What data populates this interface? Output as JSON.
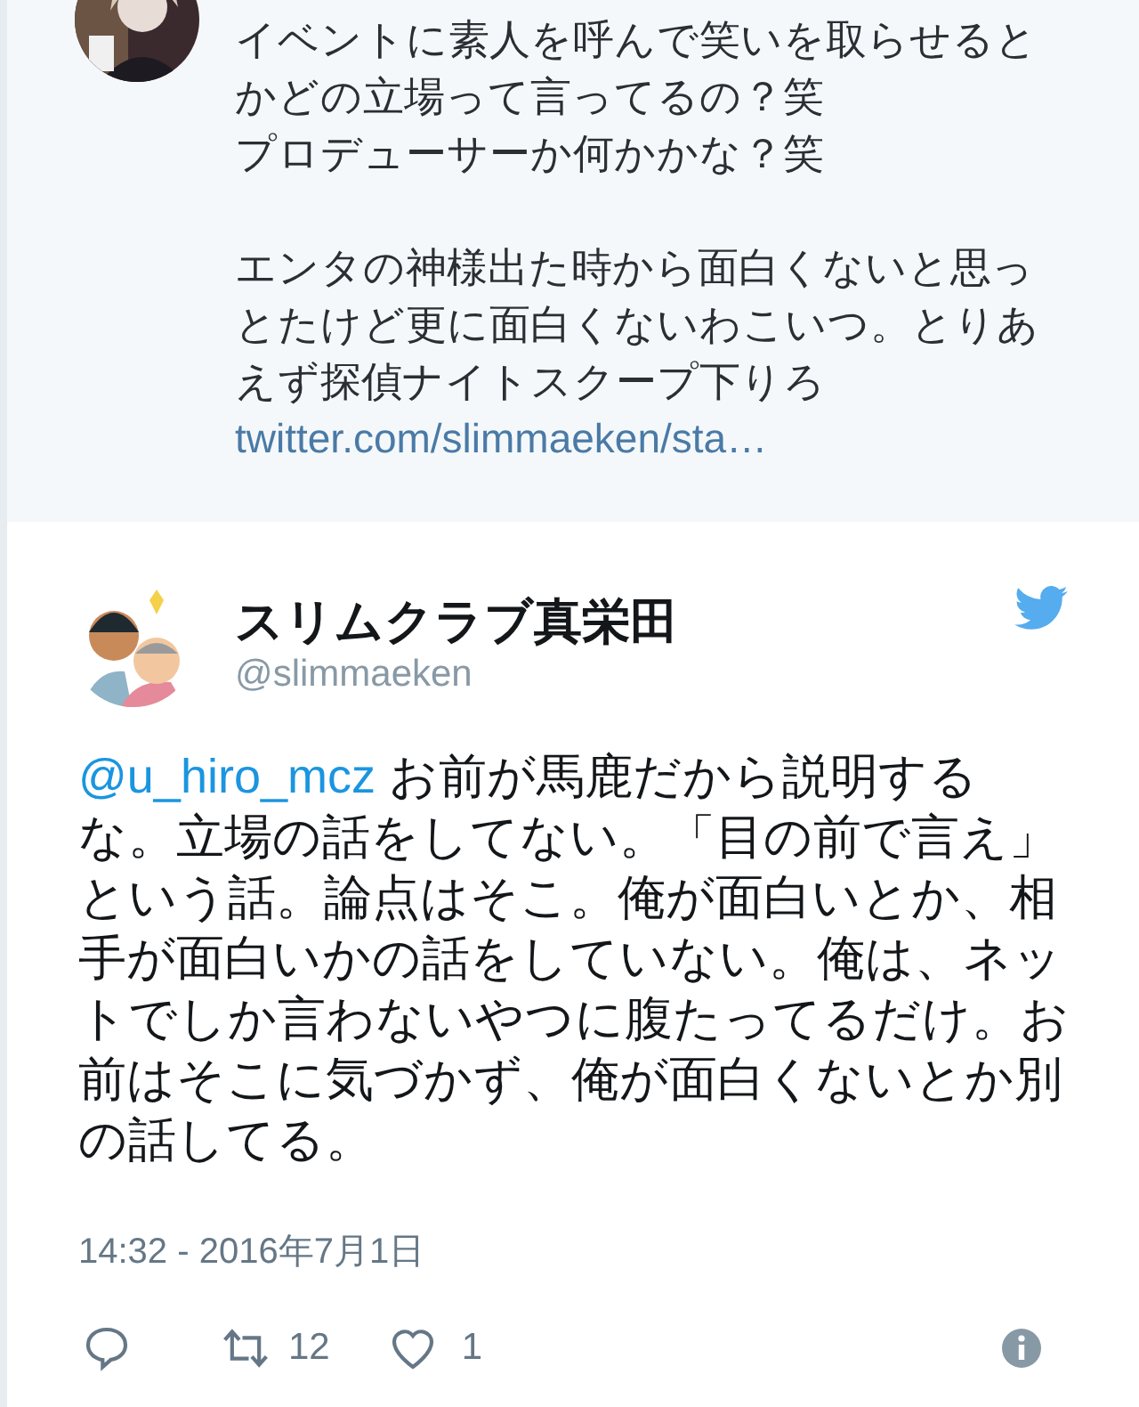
{
  "quoted_tweet": {
    "paragraphs": [
      [
        "イベントに素人を呼んで笑いを取らせると",
        "かどの立場って言ってるの？笑",
        "プロデューサーか何かかな？笑"
      ],
      [
        "エンタの神様出た時から面白くないと思っ",
        "とたけど更に面白くないわこいつ。とりあ",
        "えず探偵ナイトスクープ下りろ"
      ]
    ],
    "link": "twitter.com/slimmaeken/sta…"
  },
  "tweet": {
    "name": "スリムクラブ真栄田",
    "handle": "@slimmaeken",
    "mention": "@u_hiro_mcz",
    "lines": [
      " お前が馬鹿だから説明する",
      "な。立場の話をしてない。「目の前で言え」",
      "という話。論点はそこ。俺が面白いとか、相",
      "手が面白いかの話をしていない。俺は、ネッ",
      "トでしか言わないやつに腹たってるだけ。お",
      "前はそこに気づかず、俺が面白くないとか別",
      "の話してる。"
    ],
    "timestamp": "14:32 - 2016年7月1日",
    "retweets": "12",
    "likes": "1"
  }
}
